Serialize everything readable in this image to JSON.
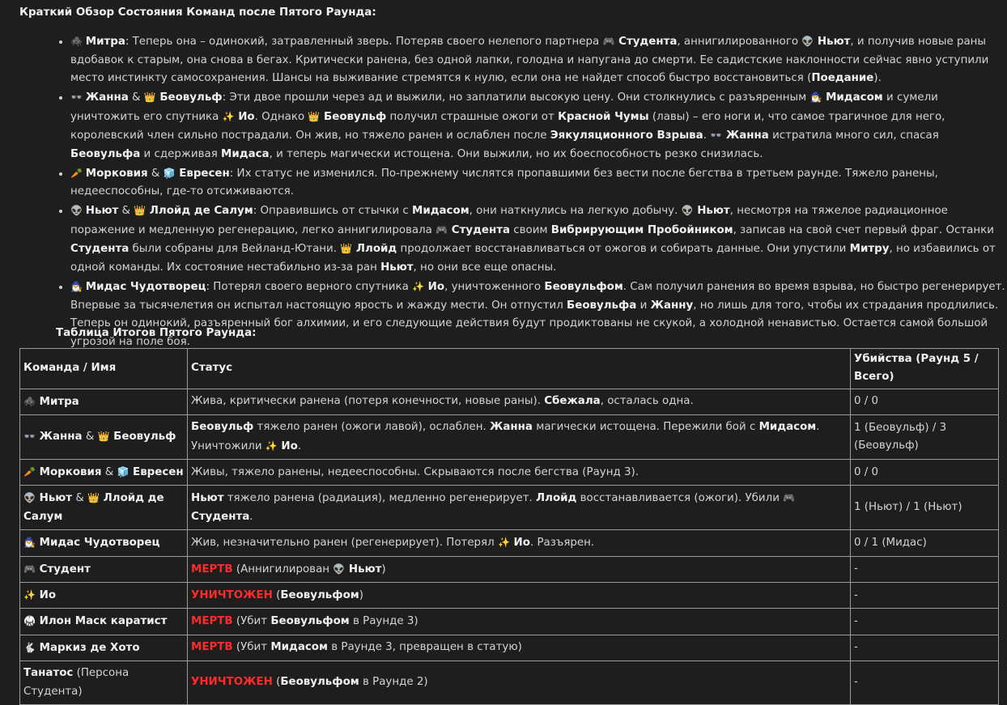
{
  "heading": "Краткий Обзор Состояния Команд после Пятого Раунда:",
  "summary_items": [
    {
      "emoji": "🕷️",
      "segments": [
        {
          "t": "Митра",
          "b": true
        },
        {
          "t": ": Теперь она – одинокий, затравленный зверь. Потеряв своего нелепого партнера "
        },
        {
          "t": "🎮",
          "e": true
        },
        {
          "t": " Студента",
          "b": true
        },
        {
          "t": ", аннигилированного "
        },
        {
          "t": "👽",
          "e": true
        },
        {
          "t": " Ньют",
          "b": true
        },
        {
          "t": ", и получив новые раны вдобавок к старым, она снова в бегах. Критически ранена, без одной лапки, голодна и напугана до смерти. Ее садистские наклонности сейчас явно уступили место инстинкту самосохранения. Шансы на выживание стремятся к нулю, если она не найдет способ быстро восстановиться ("
        },
        {
          "t": "Поедание",
          "b": true
        },
        {
          "t": ")."
        }
      ]
    },
    {
      "emoji": "👓",
      "segments": [
        {
          "t": "Жанна",
          "b": true
        },
        {
          "t": " & "
        },
        {
          "t": "👑",
          "e": true
        },
        {
          "t": " Беовульф",
          "b": true
        },
        {
          "t": ": Эти двое прошли через ад и выжили, но заплатили высокую цену. Они столкнулись с разъяренным "
        },
        {
          "t": "🧙‍♂️",
          "e": true
        },
        {
          "t": " Мидасом",
          "b": true
        },
        {
          "t": " и сумели уничтожить его спутника "
        },
        {
          "t": "✨",
          "e": true
        },
        {
          "t": " Ио",
          "b": true
        },
        {
          "t": ". Однако "
        },
        {
          "t": "👑",
          "e": true
        },
        {
          "t": " Беовульф",
          "b": true
        },
        {
          "t": " получил страшные ожоги от "
        },
        {
          "t": "Красной Чумы",
          "b": true
        },
        {
          "t": " (лавы) – его ноги и, что самое трагичное для него, королевский член сильно пострадали. Он жив, но тяжело ранен и ослаблен после "
        },
        {
          "t": "Эякуляционного Взрыва",
          "b": true
        },
        {
          "t": ". "
        },
        {
          "t": "👓",
          "e": true
        },
        {
          "t": " Жанна",
          "b": true
        },
        {
          "t": " истратила много сил, спасая "
        },
        {
          "t": "Беовульфа",
          "b": true
        },
        {
          "t": " и сдерживая "
        },
        {
          "t": "Мидаса",
          "b": true
        },
        {
          "t": ", и теперь магически истощена. Они выжили, но их боеспособность резко снизилась."
        }
      ]
    },
    {
      "emoji": "🥕",
      "segments": [
        {
          "t": "Морковия",
          "b": true
        },
        {
          "t": " & "
        },
        {
          "t": "🧊",
          "e": true
        },
        {
          "t": " Евресен",
          "b": true
        },
        {
          "t": ": Их статус не изменился. По-прежнему числятся пропавшими без вести после бегства в третьем раунде. Тяжело ранены, недееспособны, где-то отсиживаются."
        }
      ]
    },
    {
      "emoji": "👽",
      "segments": [
        {
          "t": "Ньют",
          "b": true
        },
        {
          "t": " & "
        },
        {
          "t": "👑",
          "e": true
        },
        {
          "t": " Ллойд де Салум",
          "b": true
        },
        {
          "t": ": Оправившись от стычки с "
        },
        {
          "t": "Мидасом",
          "b": true
        },
        {
          "t": ", они наткнулись на легкую добычу. "
        },
        {
          "t": "👽",
          "e": true
        },
        {
          "t": " Ньют",
          "b": true
        },
        {
          "t": ", несмотря на тяжелое радиационное поражение и медленную регенерацию, легко аннигилировала "
        },
        {
          "t": "🎮",
          "e": true
        },
        {
          "t": " Студента",
          "b": true
        },
        {
          "t": " своим "
        },
        {
          "t": "Вибрирующим Пробойником",
          "b": true
        },
        {
          "t": ", записав на свой счет первый фраг. Останки "
        },
        {
          "t": "Студента",
          "b": true
        },
        {
          "t": " были собраны для Вейланд-Ютани. "
        },
        {
          "t": "👑",
          "e": true
        },
        {
          "t": " Ллойд",
          "b": true
        },
        {
          "t": " продолжает восстанавливаться от ожогов и собирать данные. Они упустили "
        },
        {
          "t": "Митру",
          "b": true
        },
        {
          "t": ", но избавились от одной команды. Их состояние нестабильно из-за ран "
        },
        {
          "t": "Ньют",
          "b": true
        },
        {
          "t": ", но они все еще опасны."
        }
      ]
    },
    {
      "emoji": "🧙‍♂️",
      "segments": [
        {
          "t": "Мидас Чудотворец",
          "b": true
        },
        {
          "t": ": Потерял своего верного спутника "
        },
        {
          "t": "✨",
          "e": true
        },
        {
          "t": " Ио",
          "b": true
        },
        {
          "t": ", уничтоженного "
        },
        {
          "t": "Беовульфом",
          "b": true
        },
        {
          "t": ". Сам получил ранения во время взрыва, но быстро регенерирует. Впервые за тысячелетия он испытал настоящую ярость и жажду мести. Он отпустил "
        },
        {
          "t": "Беовульфа",
          "b": true
        },
        {
          "t": " и "
        },
        {
          "t": "Жанну",
          "b": true
        },
        {
          "t": ", но лишь для того, чтобы их страдания продлились. Теперь он одинокий, разъяренный бог алхимии, и его следующие действия будут продиктованы не скукой, а холодной ненавистью. Остается самой большой угрозой на поле боя."
        }
      ]
    }
  ],
  "table_title": "Таблица Итогов Пятого Раунда:",
  "table": {
    "headers": [
      "Команда / Имя",
      "Статус",
      "Убийства (Раунд 5 / Всего)"
    ],
    "rows": [
      {
        "team": [
          {
            "t": "🕷️",
            "e": true
          },
          {
            "t": " Митра",
            "b": true
          }
        ],
        "status": [
          {
            "t": "Жива, критически ранена (потеря конечности, новые раны). "
          },
          {
            "t": "Сбежала",
            "b": true
          },
          {
            "t": ", осталась одна."
          }
        ],
        "kills": "0 / 0"
      },
      {
        "team": [
          {
            "t": "👓",
            "e": true
          },
          {
            "t": " Жанна",
            "b": true
          },
          {
            "t": " & "
          },
          {
            "t": "👑",
            "e": true
          },
          {
            "t": " Беовульф",
            "b": true
          }
        ],
        "status": [
          {
            "t": "Беовульф",
            "b": true
          },
          {
            "t": " тяжело ранен (ожоги лавой), ослаблен. "
          },
          {
            "t": "Жанна",
            "b": true
          },
          {
            "t": " магически истощена. Пережили бой с "
          },
          {
            "t": "Мидасом",
            "b": true
          },
          {
            "t": ". Уничтожили "
          },
          {
            "t": "✨",
            "e": true
          },
          {
            "t": " Ио",
            "b": true
          },
          {
            "t": "."
          }
        ],
        "kills": "1 (Беовульф) / 3 (Беовульф)"
      },
      {
        "team": [
          {
            "t": "🥕",
            "e": true
          },
          {
            "t": " Морковия",
            "b": true
          },
          {
            "t": " & "
          },
          {
            "t": "🧊",
            "e": true
          },
          {
            "t": " Евресен",
            "b": true
          }
        ],
        "status": [
          {
            "t": "Живы, тяжело ранены, недееспособны. Скрываются после бегства (Раунд 3)."
          }
        ],
        "kills": "0 / 0"
      },
      {
        "team": [
          {
            "t": "👽",
            "e": true
          },
          {
            "t": " Ньют",
            "b": true
          },
          {
            "t": " & "
          },
          {
            "t": "👑",
            "e": true
          },
          {
            "t": " Ллойд де Салум",
            "b": true
          }
        ],
        "status": [
          {
            "t": "Ньют",
            "b": true
          },
          {
            "t": " тяжело ранена (радиация), медленно регенерирует. "
          },
          {
            "t": "Ллойд",
            "b": true
          },
          {
            "t": " восстанавливается (ожоги). Убили "
          },
          {
            "t": "🎮",
            "e": true
          },
          {
            "t": " Студента",
            "b": true
          },
          {
            "t": "."
          }
        ],
        "kills": "1 (Ньют) / 1 (Ньют)"
      },
      {
        "team": [
          {
            "t": "🧙‍♂️",
            "e": true
          },
          {
            "t": " Мидас Чудотворец",
            "b": true
          }
        ],
        "status": [
          {
            "t": "Жив, незначительно ранен (регенерирует). Потерял "
          },
          {
            "t": "✨",
            "e": true
          },
          {
            "t": " Ио",
            "b": true
          },
          {
            "t": ". Разъярен."
          }
        ],
        "kills": "0 / 1 (Мидас)"
      },
      {
        "team": [
          {
            "t": "🎮",
            "e": true
          },
          {
            "t": " Студент",
            "b": true
          }
        ],
        "status": [
          {
            "t": "МЕРТВ",
            "r": true
          },
          {
            "t": " (Аннигилирован "
          },
          {
            "t": "👽",
            "e": true
          },
          {
            "t": " Ньют",
            "b": true
          },
          {
            "t": ")"
          }
        ],
        "kills": "-"
      },
      {
        "team": [
          {
            "t": "✨",
            "e": true
          },
          {
            "t": " Ио",
            "b": true
          }
        ],
        "status": [
          {
            "t": "УНИЧТОЖЕН",
            "r": true
          },
          {
            "t": " ("
          },
          {
            "t": "Беовульфом",
            "b": true
          },
          {
            "t": ")"
          }
        ],
        "kills": "-"
      },
      {
        "team": [
          {
            "t": "🥋",
            "e": true
          },
          {
            "t": " Илон Маск каратист",
            "b": true
          }
        ],
        "status": [
          {
            "t": "МЕРТВ",
            "r": true
          },
          {
            "t": " (Убит "
          },
          {
            "t": "Беовульфом",
            "b": true
          },
          {
            "t": " в Раунде 3)"
          }
        ],
        "kills": "-"
      },
      {
        "team": [
          {
            "t": "🐇",
            "e": true
          },
          {
            "t": " Маркиз де Хото",
            "b": true
          }
        ],
        "status": [
          {
            "t": "МЕРТВ",
            "r": true
          },
          {
            "t": " (Убит "
          },
          {
            "t": "Мидасом",
            "b": true
          },
          {
            "t": " в Раунде 3, превращен в статую)"
          }
        ],
        "kills": "-"
      },
      {
        "team": [
          {
            "t": "Танатос",
            "b": true
          },
          {
            "t": " (Персона Студента)"
          }
        ],
        "status": [
          {
            "t": "УНИЧТОЖЕН",
            "r": true
          },
          {
            "t": " ("
          },
          {
            "t": "Беовульфом",
            "b": true
          },
          {
            "t": " в Раунде 2)"
          }
        ],
        "kills": "-"
      }
    ]
  }
}
